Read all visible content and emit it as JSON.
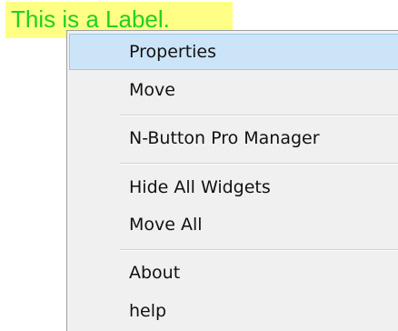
{
  "label_widget": {
    "text": "This is a Label.",
    "background_color": "#ffff85",
    "text_color": "#22cf22"
  },
  "context_menu": {
    "highlight_color": "#cce4f7",
    "groups": [
      [
        {
          "label": "Properties",
          "highlighted": true
        },
        {
          "label": "Move",
          "highlighted": false
        }
      ],
      [
        {
          "label": "N-Button Pro Manager",
          "highlighted": false
        }
      ],
      [
        {
          "label": "Hide All Widgets",
          "highlighted": false
        },
        {
          "label": "Move All",
          "highlighted": false
        }
      ],
      [
        {
          "label": "About",
          "highlighted": false
        },
        {
          "label": "help",
          "highlighted": false
        }
      ]
    ]
  }
}
